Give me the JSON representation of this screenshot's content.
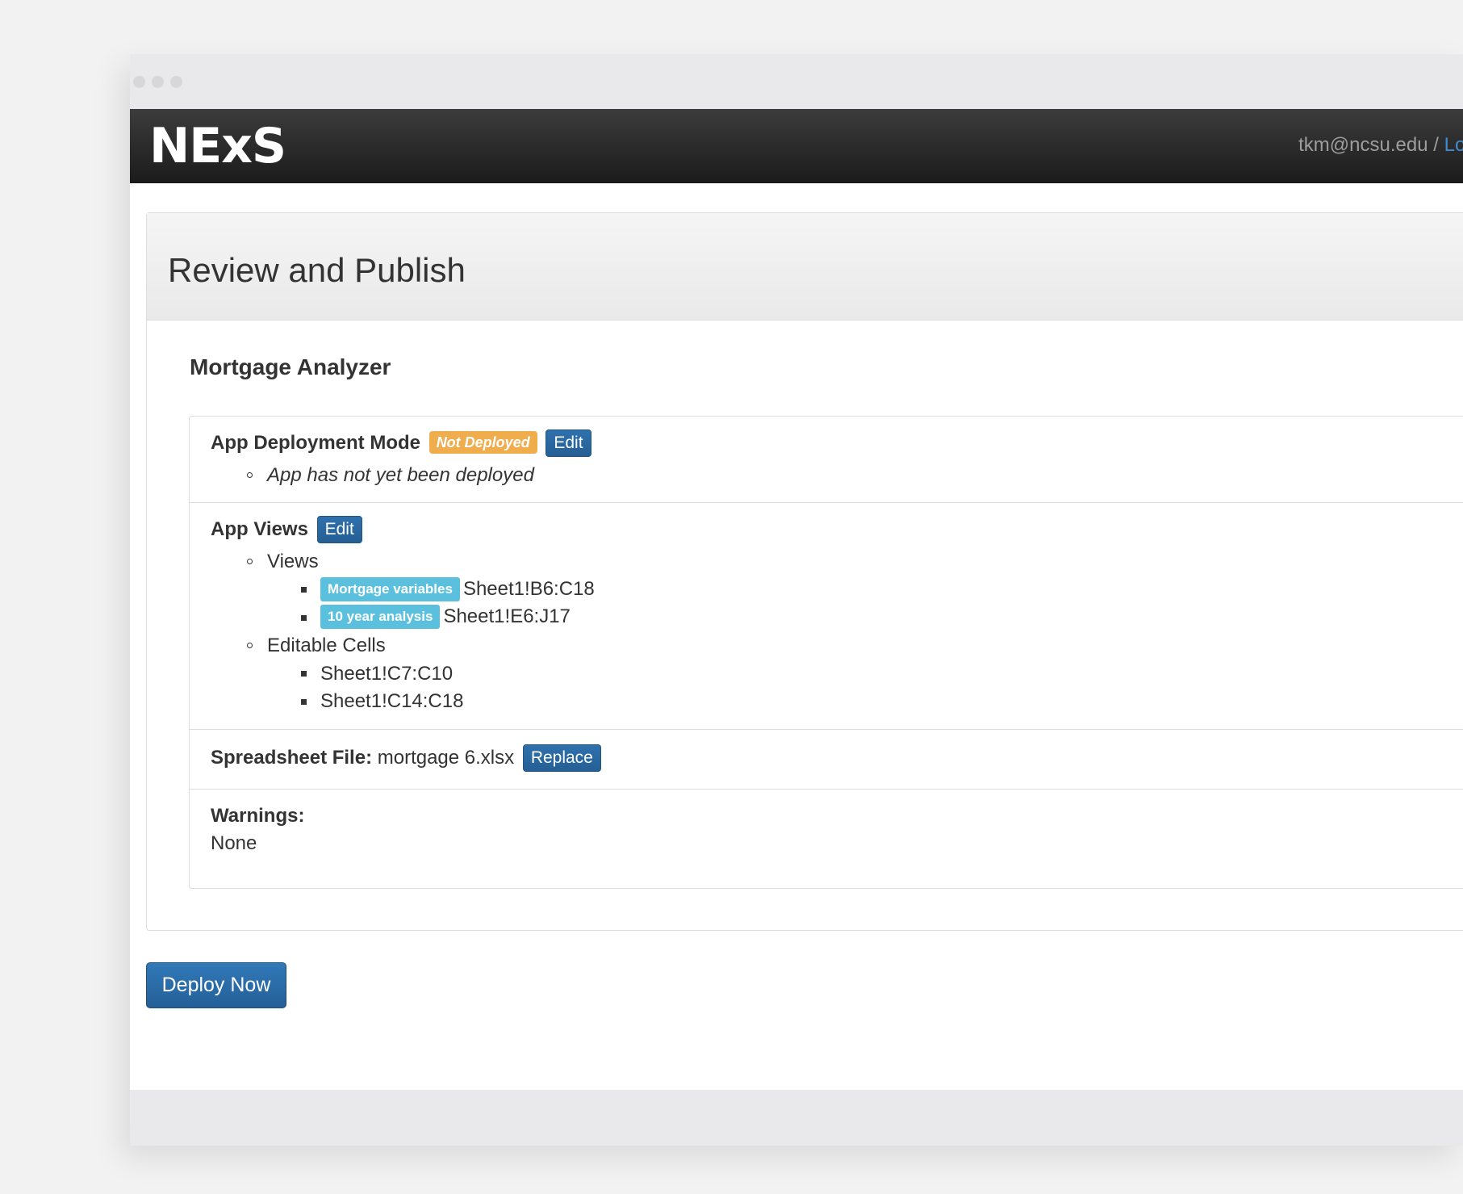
{
  "navbar": {
    "brand": "NExS",
    "user_email": "tkm@ncsu.edu",
    "separator": " / ",
    "logout_label": "Logout"
  },
  "panel": {
    "title": "Review and Publish",
    "app_name": "Mortgage Analyzer"
  },
  "deployment": {
    "heading": "App Deployment Mode",
    "status_badge": "Not Deployed",
    "edit_label": "Edit",
    "note": "App has not yet been deployed"
  },
  "views": {
    "heading": "App Views",
    "edit_label": "Edit",
    "views_label": "Views",
    "items": [
      {
        "badge": "Mortgage variables",
        "range": "Sheet1!B6:C18"
      },
      {
        "badge": "10 year analysis",
        "range": "Sheet1!E6:J17"
      }
    ],
    "editable_label": "Editable Cells",
    "editable_cells": [
      "Sheet1!C7:C10",
      "Sheet1!C14:C18"
    ]
  },
  "spreadsheet": {
    "label": "Spreadsheet File:",
    "filename": "mortgage 6.xlsx",
    "replace_label": "Replace"
  },
  "warnings": {
    "label": "Warnings:",
    "value": "None"
  },
  "deploy_button": "Deploy Now",
  "colors": {
    "warning": "#f0ad4e",
    "info": "#5bc0de",
    "primary": "#2a6496",
    "navbar": "#222222",
    "link": "#428bca"
  }
}
